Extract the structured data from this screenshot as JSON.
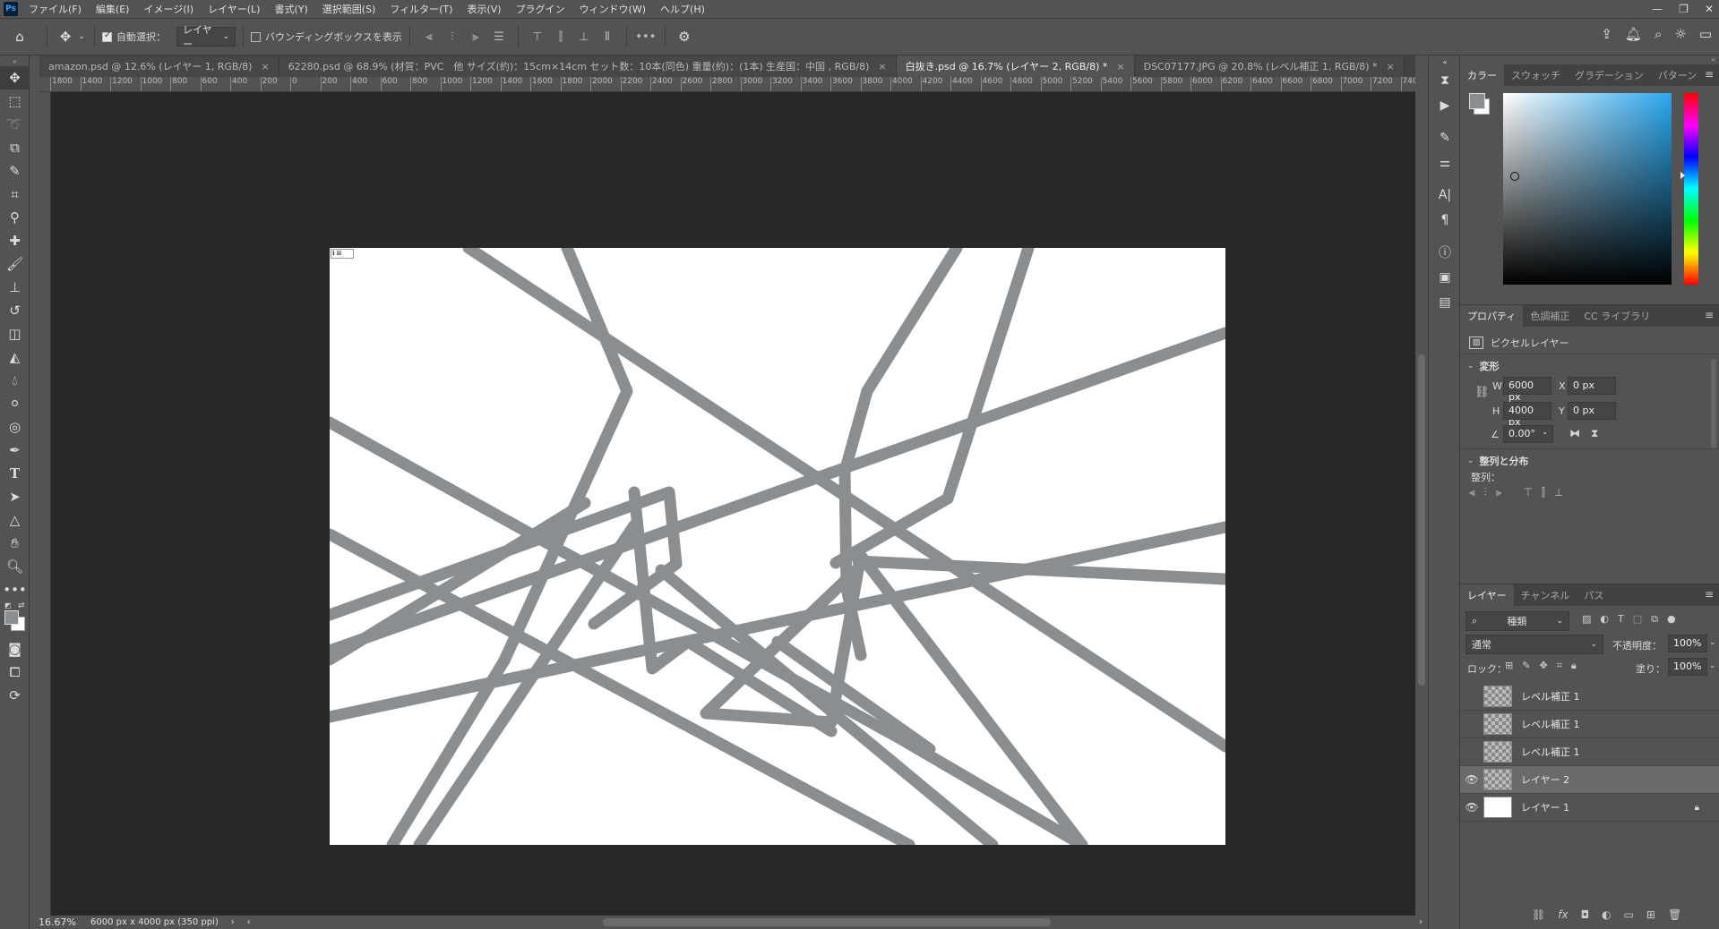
{
  "app": {
    "logo": "Ps"
  },
  "menu": [
    "ファイル(F)",
    "編集(E)",
    "イメージ(I)",
    "レイヤー(L)",
    "書式(Y)",
    "選択範囲(S)",
    "フィルター(T)",
    "表示(V)",
    "プラグイン",
    "ウィンドウ(W)",
    "ヘルプ(H)"
  ],
  "options": {
    "auto_select_label": "自動選択：",
    "auto_select_target": "レイヤー",
    "show_bbox_label": "バウンディングボックスを表示"
  },
  "tabs": [
    {
      "label": "amazon.psd @ 12.6% (レイヤー 1, RGB/8)",
      "active": false
    },
    {
      "label": "62280.psd @ 68.9% (材質：PVC　他 サイズ(約)：15cm×14cm セット数：10本(同色) 重量(約)：(1本) 生産国：中国 , RGB/8)",
      "active": false
    },
    {
      "label": "白抜き.psd @ 16.7% (レイヤー 2, RGB/8) *",
      "active": true
    },
    {
      "label": "DSC07177.JPG @ 20.8% (レベル補正 1, RGB/8) *",
      "active": false
    }
  ],
  "ruler_ticks": [
    "1800",
    "1400",
    "1200",
    "1000",
    "800",
    "600",
    "400",
    "200",
    "0",
    "200",
    "400",
    "600",
    "800",
    "1000",
    "1200",
    "1400",
    "1600",
    "1800",
    "2000",
    "2200",
    "2400",
    "2600",
    "2800",
    "3000",
    "3200",
    "3400",
    "3600",
    "3800",
    "4000",
    "4200",
    "4400",
    "4600",
    "4800",
    "5000",
    "5200",
    "5400",
    "5600",
    "5800",
    "6000",
    "6200",
    "6400",
    "6600",
    "6800",
    "7000",
    "7200",
    "7400"
  ],
  "status": {
    "zoom": "16.67%",
    "doc_info": "6000 px x 4000 px (350 ppi)"
  },
  "color_panel": {
    "tabs": [
      "カラー",
      "スウォッチ",
      "グラデーション",
      "パターン"
    ],
    "fg_color": "#8a8e91",
    "bg_color": "#ffffff"
  },
  "properties": {
    "tabs": [
      "プロパティ",
      "色調補正",
      "CC ライブラリ"
    ],
    "layer_type": "ピクセルレイヤー",
    "transform_label": "変形",
    "w_label": "W",
    "w": "6000 px",
    "h_label": "H",
    "h": "4000 px",
    "x_label": "X",
    "x": "0 px",
    "y_label": "Y",
    "y": "0 px",
    "angle": "0.00°",
    "align_label": "整列と分布",
    "align_sub": "整列："
  },
  "layers_panel": {
    "tabs": [
      "レイヤー",
      "チャンネル",
      "パス"
    ],
    "filter_kind": "種類",
    "blend_mode": "通常",
    "opacity_label": "不透明度：",
    "opacity": "100%",
    "lock_label": "ロック：",
    "fill_label": "塗り：",
    "fill": "100%",
    "layers": [
      {
        "name": "レベル補正 1",
        "visible": false,
        "selected": false,
        "thumb": "checker",
        "locked": false
      },
      {
        "name": "レベル補正 1",
        "visible": false,
        "selected": false,
        "thumb": "checker",
        "locked": false
      },
      {
        "name": "レベル補正 1",
        "visible": false,
        "selected": false,
        "thumb": "checker",
        "locked": false
      },
      {
        "name": "レイヤー 2",
        "visible": true,
        "selected": true,
        "thumb": "checker",
        "locked": false
      },
      {
        "name": "レイヤー 1",
        "visible": true,
        "selected": false,
        "thumb": "white",
        "locked": true
      }
    ]
  },
  "canvas_art": {
    "stroke_color": "#8a8e91"
  }
}
